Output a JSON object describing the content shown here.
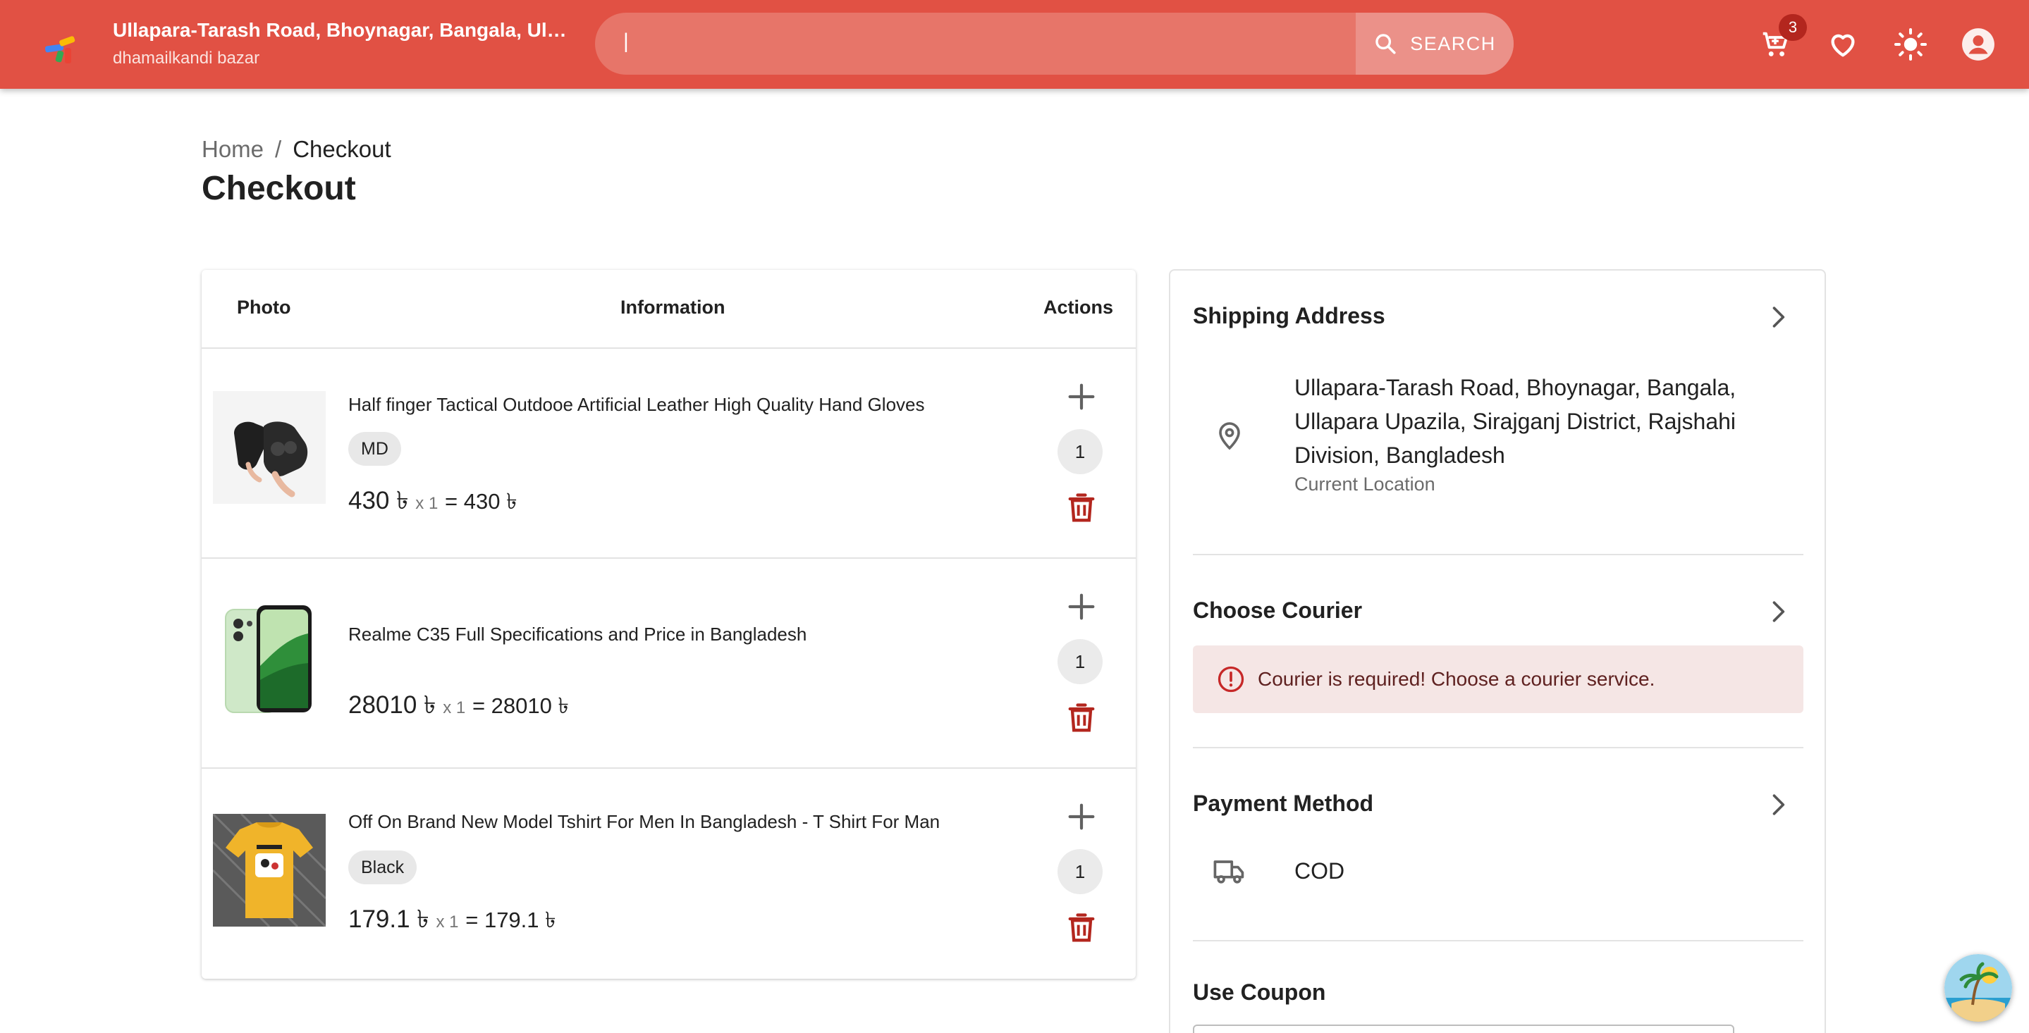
{
  "header": {
    "address_title": "Ullapara-Tarash Road, Bhoynagar, Bangala, Ullapara Upazila, Sirajganj District, Rajshahi Division, Bangladesh",
    "address_sub": "dhamailkandi bazar",
    "search_value": "|",
    "search_label": "SEARCH",
    "cart_count": "3",
    "icons": [
      "cart-icon",
      "heart-icon",
      "sun-icon",
      "account-icon"
    ]
  },
  "breadcrumb": {
    "home": "Home",
    "separator": "/",
    "current": "Checkout"
  },
  "page_title": "Checkout",
  "cart": {
    "columns": [
      "Photo",
      "Information",
      "Actions"
    ],
    "items": [
      {
        "name": "Half finger Tactical Outdooe Artificial Leather High Quality Hand Gloves",
        "variant": "MD",
        "price": "430 ৳",
        "mult": "x 1",
        "total": "= 430 ৳",
        "qty": "1"
      },
      {
        "name": "Realme C35 Full Specifications and Price in Bangladesh",
        "variant": "",
        "price": "28010 ৳",
        "mult": "x 1",
        "total": "= 28010 ৳",
        "qty": "1"
      },
      {
        "name": "Off On Brand New Model Tshirt For Men In Bangladesh - T Shirt For Man",
        "variant": "Black",
        "price": "179.1 ৳",
        "mult": "x 1",
        "total": "= 179.1 ৳",
        "qty": "1"
      }
    ]
  },
  "panel": {
    "shipping_title": "Shipping Address",
    "shipping_address": "Ullapara-Tarash Road, Bhoynagar, Bangala, Ullapara Upazila, Sirajganj District, Rajshahi Division, Bangladesh",
    "shipping_sub": "Current Location",
    "courier_title": "Choose Courier",
    "courier_error": "Courier is required! Choose a courier service.",
    "payment_title": "Payment Method",
    "payment_value": "COD",
    "coupon_title": "Use Coupon"
  },
  "colors": {
    "header_bg": "#e15144",
    "danger": "#b3261e",
    "alert_bg": "#f5e6e5"
  }
}
